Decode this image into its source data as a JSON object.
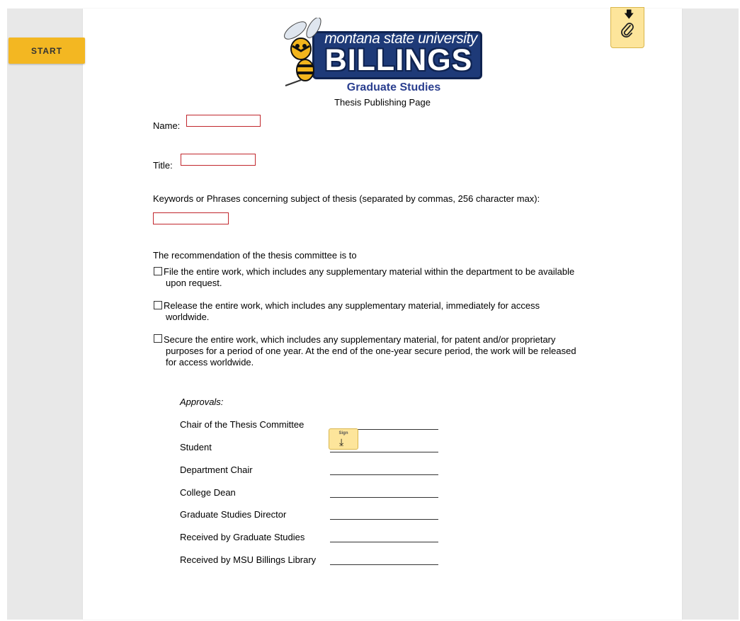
{
  "toolbar": {
    "start_label": "START"
  },
  "header": {
    "logo_top": "montana state university",
    "logo_main": "BILLINGS",
    "dept": "Graduate Studies",
    "subtitle": "Thesis Publishing Page"
  },
  "form": {
    "name_label": "Name:",
    "name_value": "",
    "title_label": "Title:",
    "title_value": "",
    "keywords_label": "Keywords or Phrases concerning subject of thesis (separated by commas, 256 character max):",
    "keywords_value": "",
    "recommendation_label": "The recommendation of the thesis committee is to",
    "options": [
      {
        "line1": "File the entire work, which includes any supplementary material within the department to be available",
        "line2": "upon request.",
        "line3": "",
        "checked": false
      },
      {
        "line1": "Release the entire work, which includes any supplementary material, immediately for access",
        "line2": "worldwide.",
        "line3": "",
        "checked": false
      },
      {
        "line1": "Secure the entire work, which includes any supplementary material, for patent and/or proprietary",
        "line2": "purposes for a period of one year.  At the end of the one-year secure period, the work will be released",
        "line3": "for access worldwide.",
        "checked": false
      }
    ]
  },
  "approvals": {
    "heading": "Approvals:",
    "roles": [
      "Chair of the Thesis Committee",
      "Student",
      "Department Chair",
      "College Dean",
      "Graduate Studies Director",
      "Received by Graduate Studies",
      "Received by MSU Billings Library"
    ],
    "sign_label": "Sign"
  },
  "colors": {
    "accent": "#f3b722",
    "tag": "#fde59b",
    "field_border": "#c1272d",
    "brand_blue": "#1e3a78"
  },
  "icons": {
    "attach": "paperclip-icon",
    "download": "download-arrow-icon"
  }
}
